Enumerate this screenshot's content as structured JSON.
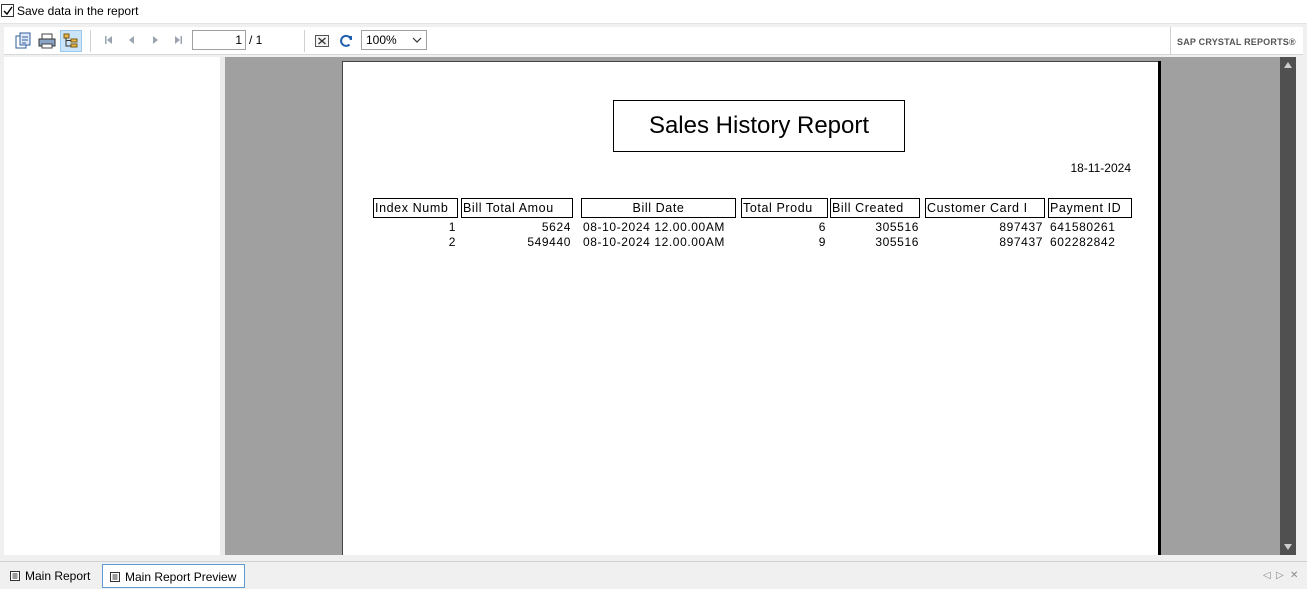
{
  "top": {
    "save_checkbox_label": "Save data in the report",
    "save_checked": true
  },
  "toolbar": {
    "page_current": "1",
    "page_total": "/ 1",
    "zoom": "100%",
    "brand": "SAP CRYSTAL REPORTS®"
  },
  "report": {
    "title": "Sales History Report",
    "date": "18-11-2024",
    "columns": [
      "Index Numb",
      "Bill Total Amou",
      "Bill Date",
      "Total Produ",
      "Bill Created",
      "Customer Card I",
      "Payment ID"
    ],
    "rows": [
      [
        "1",
        "5624",
        "08-10-2024 12.00.00AM",
        "6",
        "305516",
        "897437",
        "641580261"
      ],
      [
        "2",
        "549440",
        "08-10-2024 12.00.00AM",
        "9",
        "305516",
        "897437",
        "602282842"
      ]
    ]
  },
  "tabs": [
    {
      "label": "Main Report",
      "active": false
    },
    {
      "label": "Main Report Preview",
      "active": true
    }
  ]
}
